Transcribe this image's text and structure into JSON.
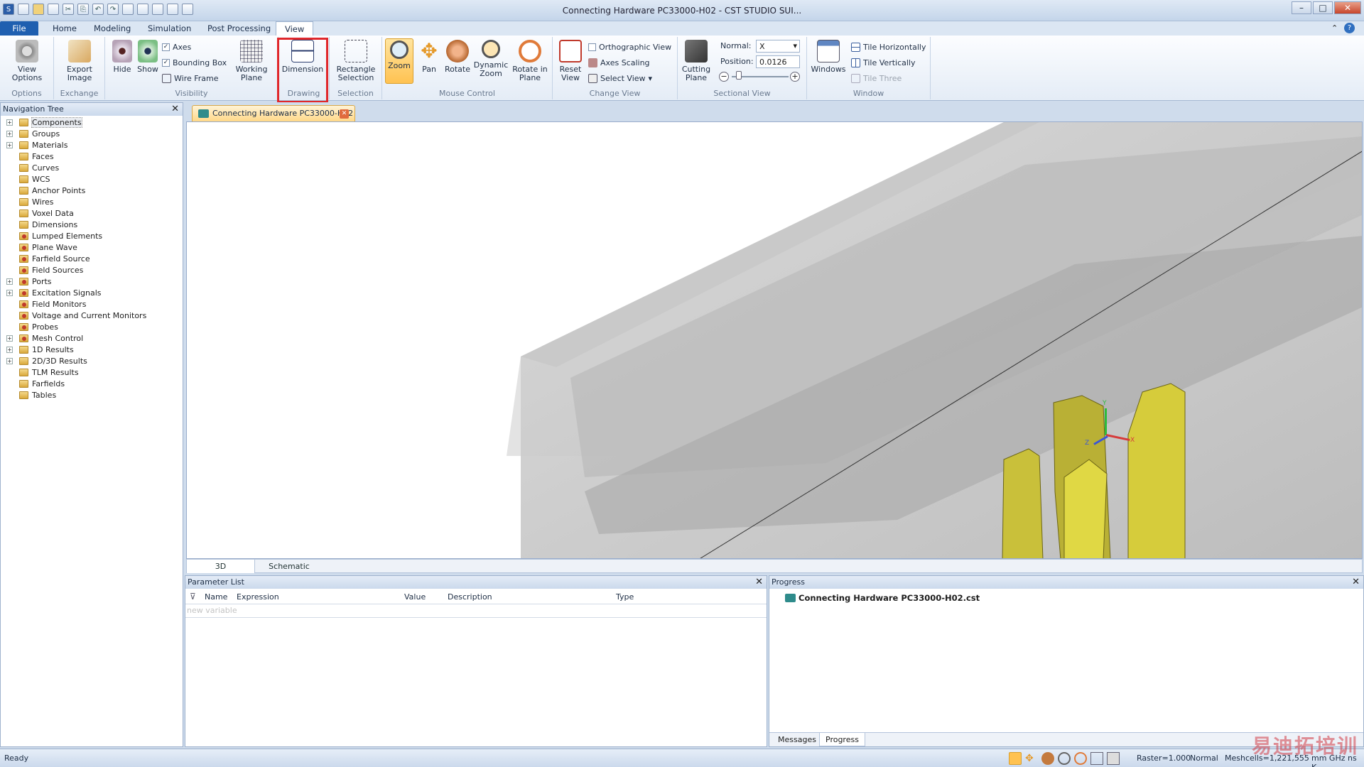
{
  "window": {
    "title": "Connecting Hardware PC33000-H02 - CST STUDIO SUI..."
  },
  "menu": {
    "tabs": [
      "File",
      "Home",
      "Modeling",
      "Simulation",
      "Post Processing",
      "View"
    ],
    "active": "View"
  },
  "ribbon": {
    "options": {
      "view_options": "View Options",
      "label": "Options"
    },
    "exchange": {
      "export_image": "Export Image",
      "label": "Exchange"
    },
    "visibility": {
      "hide": "Hide",
      "show": "Show",
      "axes": "Axes",
      "bounding_box": "Bounding Box",
      "wire_frame": "Wire Frame",
      "working_plane": "Working Plane",
      "label": "Visibility"
    },
    "drawing": {
      "dimension": "Dimension",
      "label": "Drawing"
    },
    "selection": {
      "rectangle_selection": "Rectangle Selection",
      "label": "Selection"
    },
    "mouse_control": {
      "zoom": "Zoom",
      "pan": "Pan",
      "rotate": "Rotate",
      "dynamic_zoom": "Dynamic Zoom",
      "rotate_in_plane": "Rotate in Plane",
      "label": "Mouse Control"
    },
    "change_view": {
      "reset_view": "Reset View",
      "orthographic_view": "Orthographic View",
      "axes_scaling": "Axes Scaling",
      "select_view": "Select View",
      "label": "Change View"
    },
    "sectional_view": {
      "cutting_plane": "Cutting Plane",
      "normal_label": "Normal:",
      "normal_value": "X",
      "position_label": "Position:",
      "position_value": "0.0126",
      "label": "Sectional View"
    },
    "window": {
      "windows": "Windows",
      "tile_horizontally": "Tile Horizontally",
      "tile_vertically": "Tile Vertically",
      "tile_three": "Tile Three",
      "label": "Window"
    }
  },
  "nav_tree": {
    "title": "Navigation Tree",
    "items": [
      "Components",
      "Groups",
      "Materials",
      "Faces",
      "Curves",
      "WCS",
      "Anchor Points",
      "Wires",
      "Voxel Data",
      "Dimensions",
      "Lumped Elements",
      "Plane Wave",
      "Farfield Source",
      "Field Sources",
      "Ports",
      "Excitation Signals",
      "Field Monitors",
      "Voltage and Current Monitors",
      "Probes",
      "Mesh Control",
      "1D Results",
      "2D/3D Results",
      "TLM Results",
      "Farfields",
      "Tables"
    ]
  },
  "document": {
    "tab_label": "Connecting Hardware PC33000-H02"
  },
  "view_tabs": [
    "3D",
    "Schematic"
  ],
  "parameter_list": {
    "title": "Parameter List",
    "columns": [
      "Name",
      "Expression",
      "Value",
      "Description",
      "Type"
    ],
    "placeholder": "new variable"
  },
  "progress": {
    "title": "Progress",
    "file": "Connecting Hardware PC33000-H02.cst",
    "tabs": [
      "Messages",
      "Progress"
    ]
  },
  "status": {
    "ready": "Ready",
    "raster": "Raster=1.000",
    "mode": "Normal",
    "meshcells": "Meshcells=1,221,555",
    "units": "mm GHz ns K"
  },
  "watermark": "易迪拓培训",
  "axes_labels": {
    "y": "Y",
    "z": "Z",
    "x": "X"
  }
}
